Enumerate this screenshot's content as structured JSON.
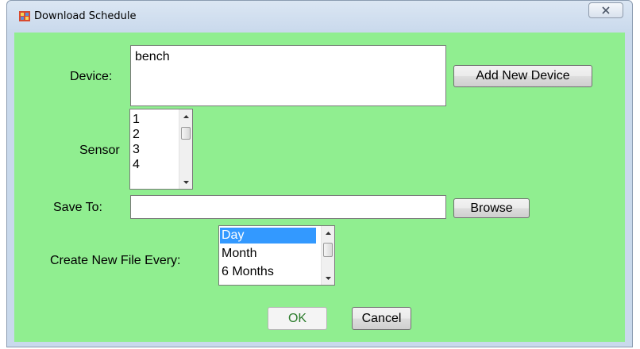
{
  "window": {
    "title": "Download Schedule"
  },
  "form": {
    "device_label": "Device:",
    "device_value": "bench",
    "add_device_button": "Add New Device",
    "sensor_label": "Sensor",
    "sensors": [
      "1",
      "2",
      "3",
      "4"
    ],
    "save_to_label": "Save To:",
    "save_to_value": "",
    "browse_button": "Browse",
    "frequency_label": "Create New File Every:",
    "frequency_options": [
      "Day",
      "Month",
      "6 Months"
    ],
    "frequency_selected": "Day",
    "ok_button": "OK",
    "cancel_button": "Cancel"
  },
  "colors": {
    "client_background": "#90ee90",
    "selection": "#3399ff"
  }
}
